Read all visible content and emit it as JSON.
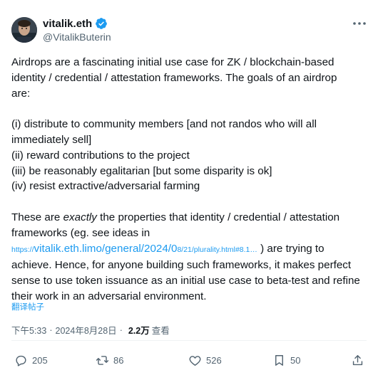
{
  "author": {
    "display_name": "vitalik.eth",
    "handle": "@VitalikButerin"
  },
  "tweet": {
    "line1": "Airdrops are a fascinating initial use case for ZK / blockchain-based",
    "line2": "identity / credential / attestation frameworks. The goals of an airdrop",
    "line3": "are:",
    "line4": "(i) distribute to community members [and not randos who will all",
    "line5": "immediately sell]",
    "line6": "(ii) reward contributions to the project",
    "line7": "(iii) be reasonably egalitarian [but some disparity is ok]",
    "line8": "(iv) resist extractive/adversarial farming",
    "line9_pre": "These are ",
    "line9_em": "exactly",
    "line9_post": " the properties that identity / credential / attestation",
    "line10": "frameworks (eg. see ideas in",
    "link_prefix": "https://",
    "link_main": "vitalik.eth.limo/general/2024/0",
    "link_tail": "8/21/plurality.html#8.1…",
    "line11_post": " ) are trying to",
    "line12": "achieve. Hence, for anyone building such frameworks, it makes perfect",
    "line13": "sense to use token issuance as an initial use case to beta-test and refine",
    "line14": "their work in an adversarial environment."
  },
  "translate_label": "翻译帖子",
  "meta": {
    "time": "下午5:33",
    "date": "2024年8月28日",
    "separator1": "·",
    "separator2": "·",
    "views_count": "2.2万",
    "views_label": "查看"
  },
  "actions": {
    "replies": "205",
    "reposts": "86",
    "likes": "526",
    "bookmarks": "50"
  },
  "colors": {
    "link": "#1d9bf0",
    "verified": "#1d9bf0",
    "secondary_text": "#536471"
  }
}
